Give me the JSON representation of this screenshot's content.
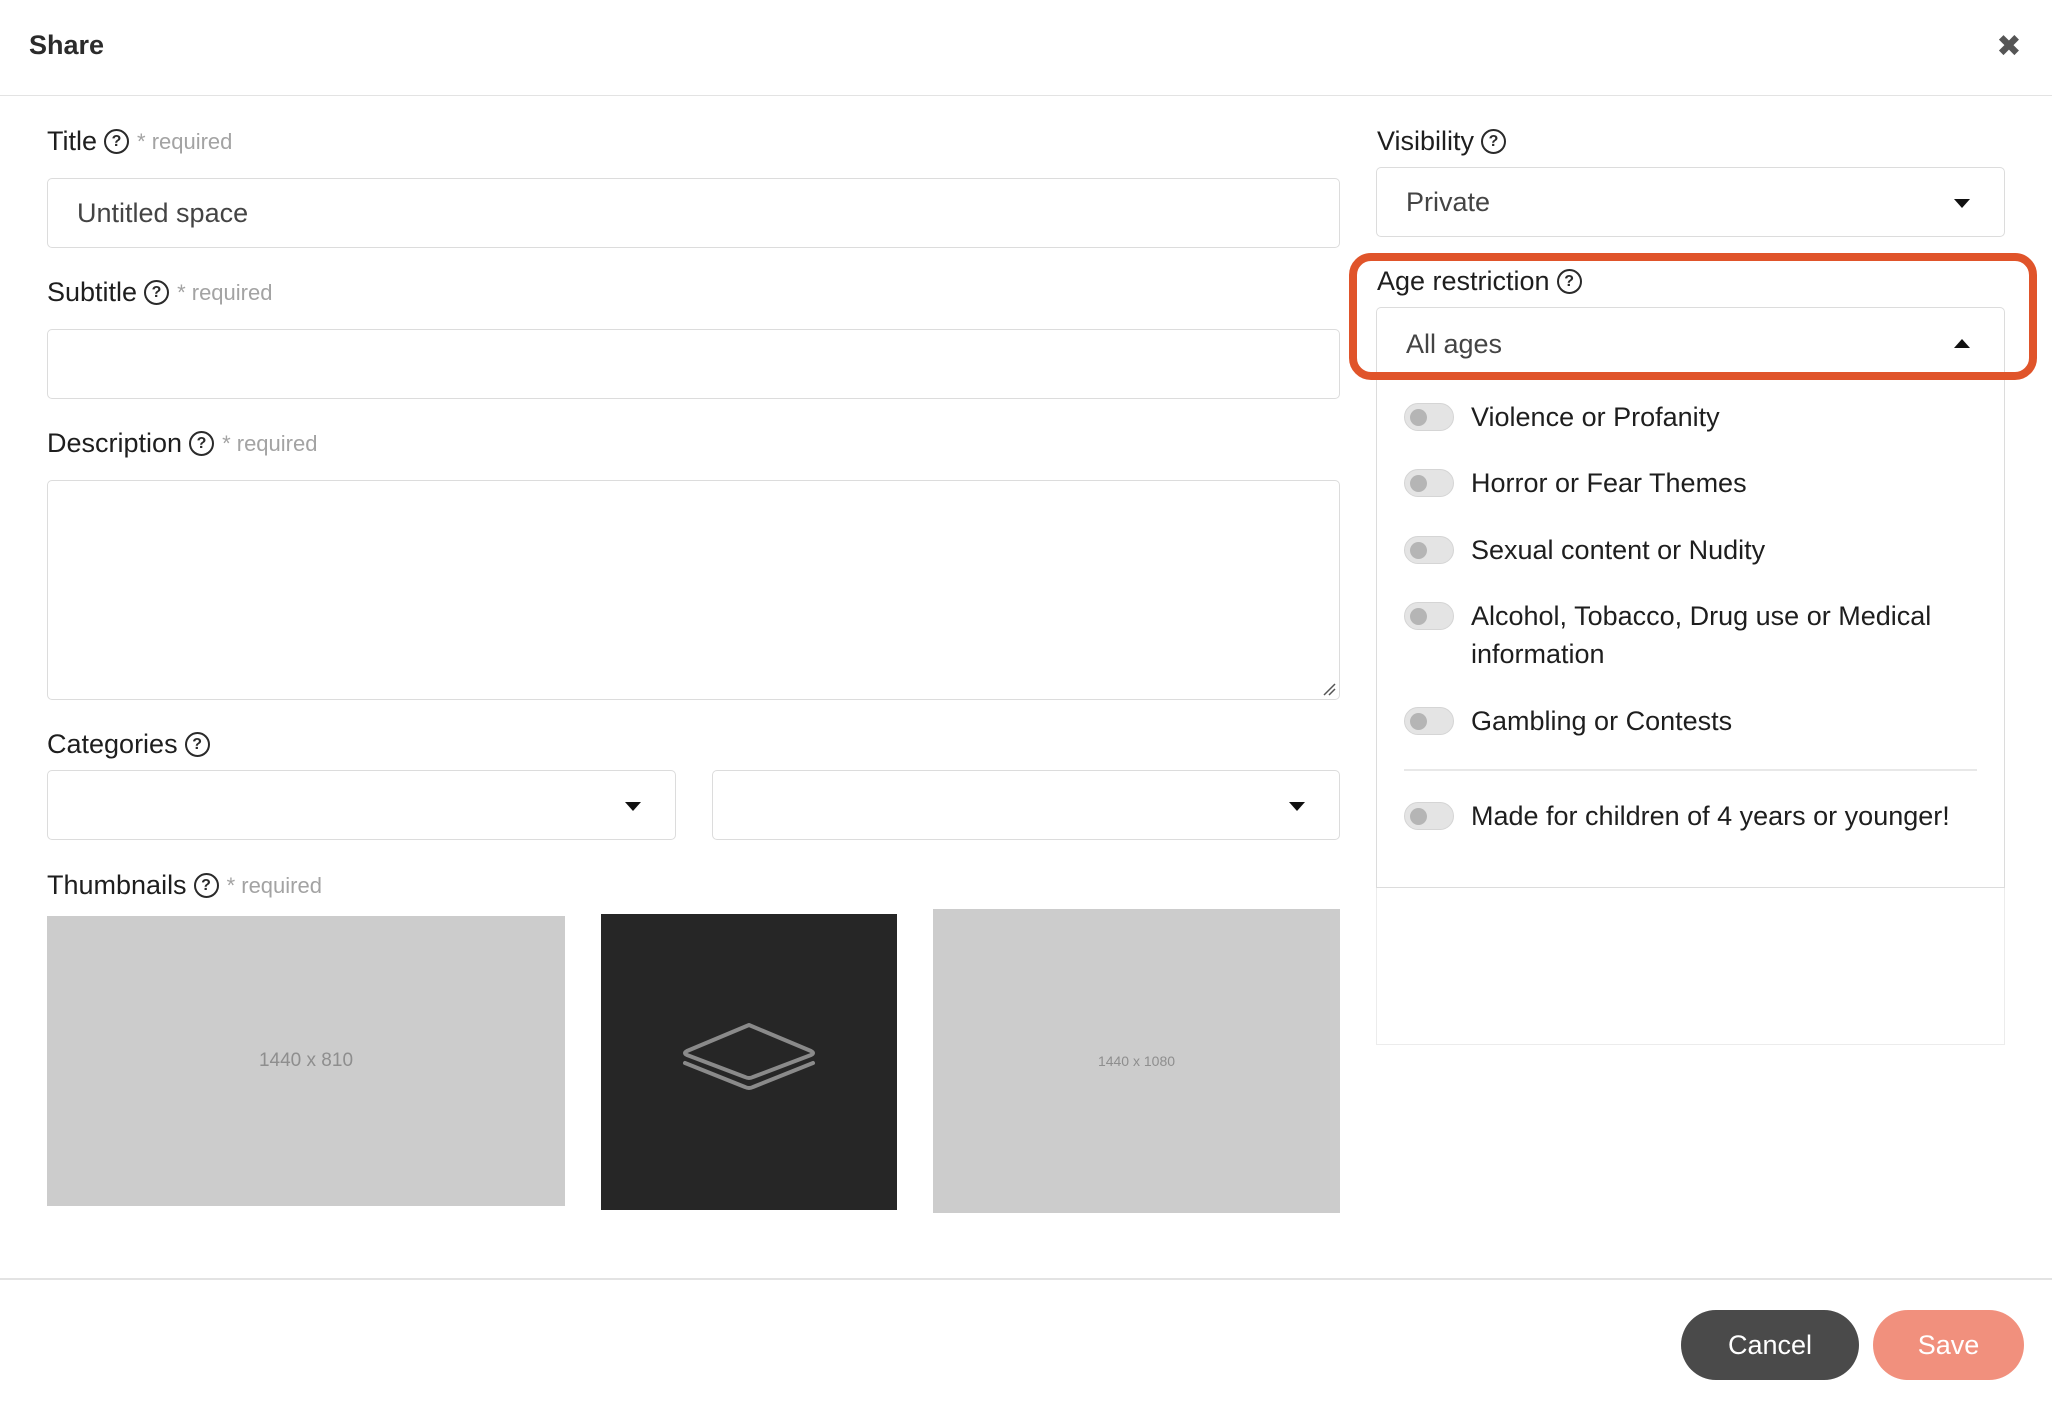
{
  "dialog": {
    "title": "Share",
    "close_symbol": "✖"
  },
  "form": {
    "title": {
      "label": "Title",
      "required": "* required",
      "value": "Untitled space"
    },
    "subtitle": {
      "label": "Subtitle",
      "required": "* required",
      "value": ""
    },
    "description": {
      "label": "Description",
      "required": "* required",
      "value": ""
    },
    "categories": {
      "label": "Categories",
      "first_value": "",
      "second_value": ""
    },
    "thumbnails": {
      "label": "Thumbnails",
      "required": "* required",
      "items": [
        {
          "caption": "1440 x 810"
        },
        {
          "caption": "",
          "icon": "layers-icon"
        },
        {
          "caption": "1440 x 1080"
        }
      ]
    }
  },
  "visibility": {
    "label": "Visibility",
    "value": "Private"
  },
  "age_restriction": {
    "label": "Age restriction",
    "value": "All ages",
    "options": [
      {
        "label": "Violence or Profanity",
        "on": false
      },
      {
        "label": "Horror or Fear Themes",
        "on": false
      },
      {
        "label": "Sexual content or Nudity",
        "on": false
      },
      {
        "label": "Alcohol, Tobacco, Drug use or Medical information",
        "on": false
      },
      {
        "label": "Gambling or Contests",
        "on": false
      }
    ],
    "children_option": {
      "label": "Made for children of 4 years or younger!",
      "on": false
    }
  },
  "help_symbol": "?",
  "footer": {
    "cancel_label": "Cancel",
    "save_label": "Save"
  },
  "colors": {
    "highlight": "#e0542a",
    "save": "#f1907d",
    "cancel": "#4a4a4a"
  }
}
